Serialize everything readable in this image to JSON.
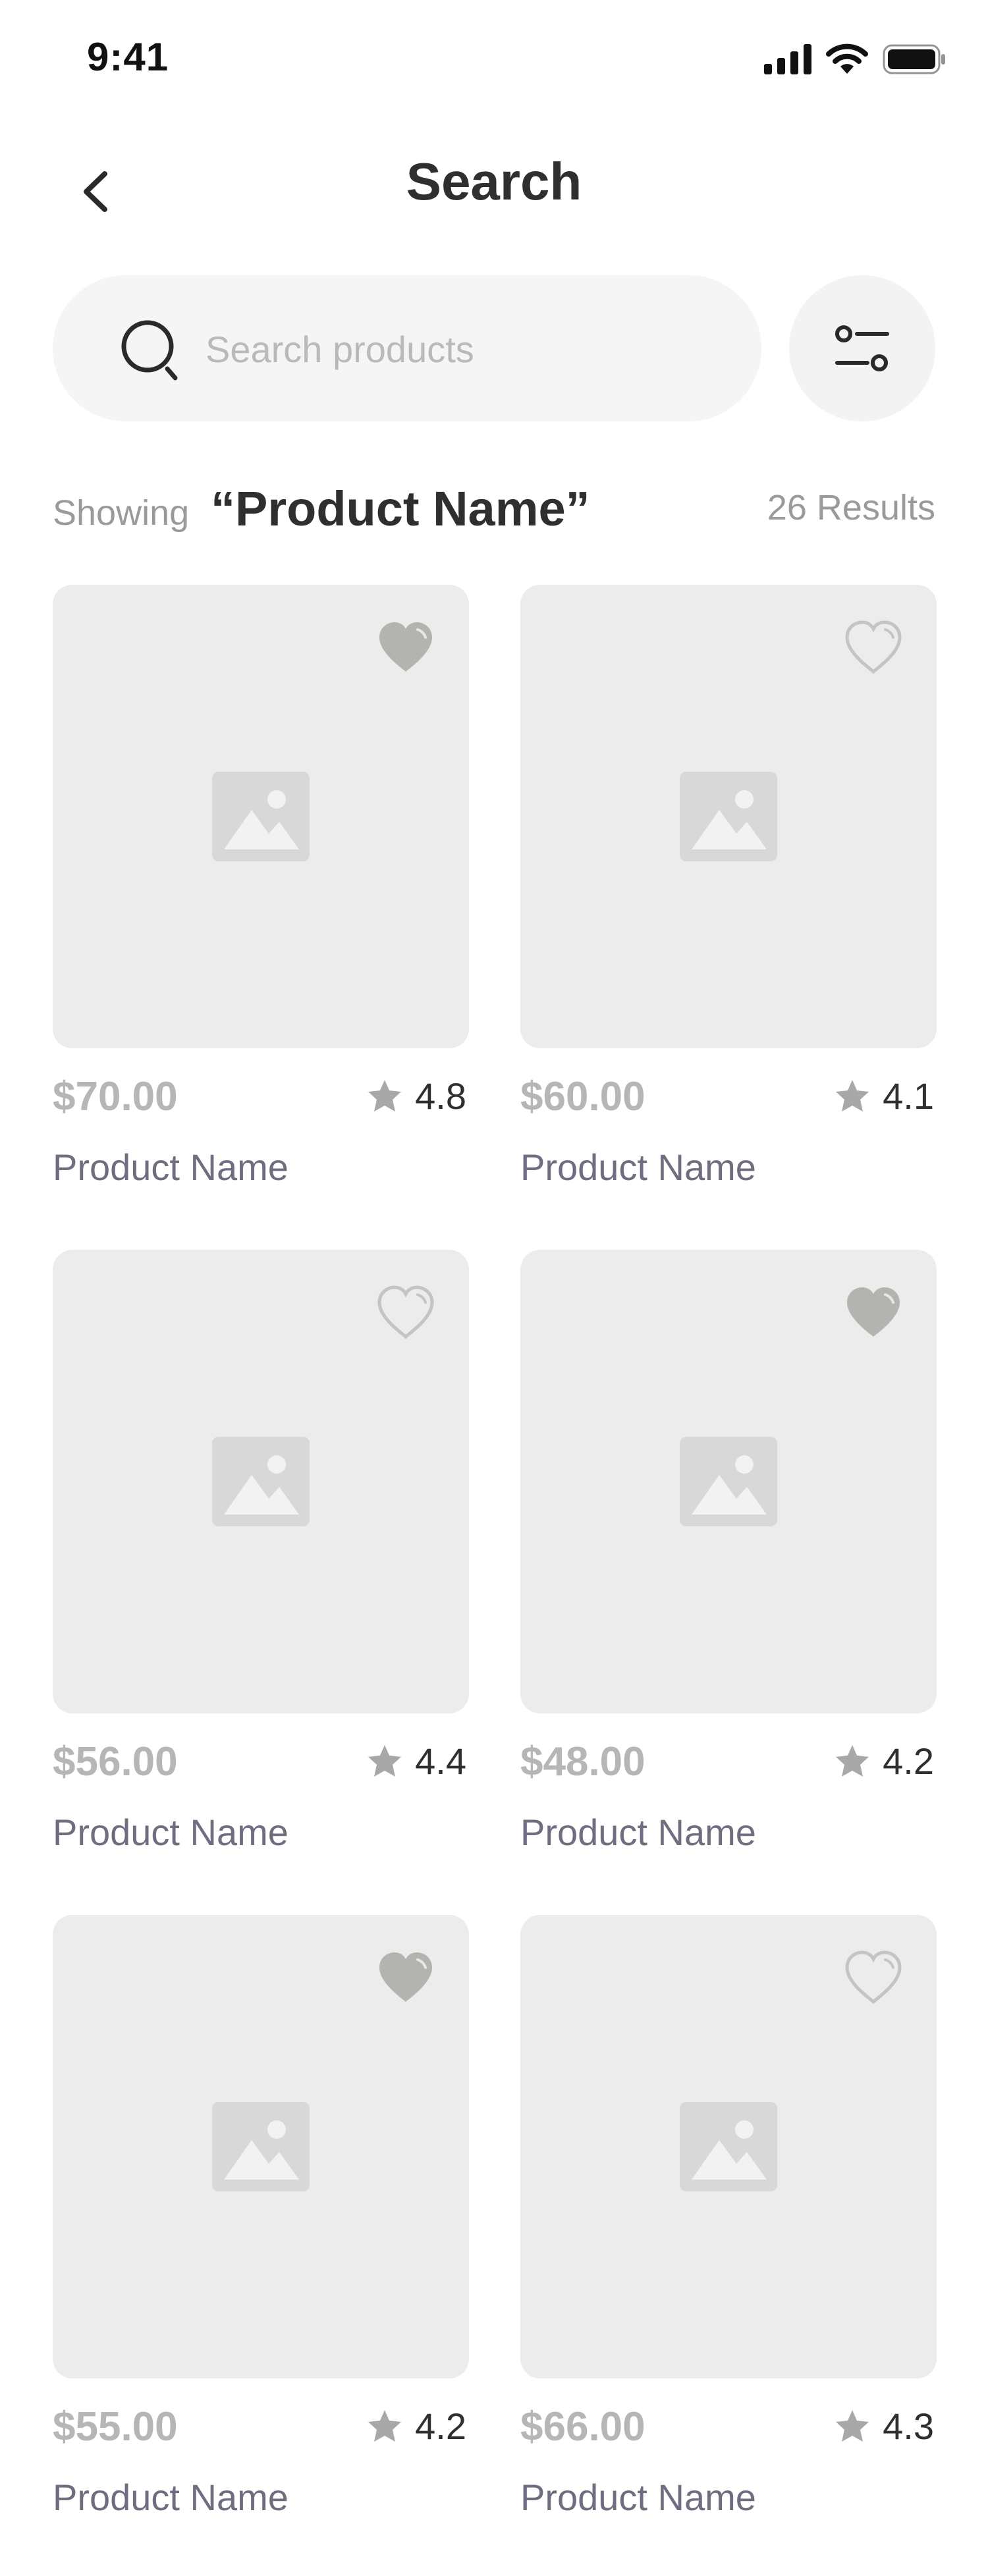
{
  "status_bar": {
    "time": "9:41",
    "icons": [
      "cellular-signal-icon",
      "wifi-icon",
      "battery-icon"
    ]
  },
  "header": {
    "back_icon": "chevron-left-icon",
    "title": "Search"
  },
  "search": {
    "icon": "search-icon",
    "placeholder": "Search products",
    "value": "",
    "filter_icon": "filter-sliders-icon"
  },
  "results": {
    "showing_label": "Showing",
    "query": "“Product Name”",
    "count": "26 Results"
  },
  "products": [
    {
      "price": "$70.00",
      "rating": "4.8",
      "name": "Product Name",
      "favorited": true
    },
    {
      "price": "$60.00",
      "rating": "4.1",
      "name": "Product Name",
      "favorited": false
    },
    {
      "price": "$56.00",
      "rating": "4.4",
      "name": "Product Name",
      "favorited": false
    },
    {
      "price": "$48.00",
      "rating": "4.2",
      "name": "Product Name",
      "favorited": true
    },
    {
      "price": "$55.00",
      "rating": "4.2",
      "name": "Product Name",
      "favorited": true
    },
    {
      "price": "$66.00",
      "rating": "4.3",
      "name": "Product Name",
      "favorited": false
    }
  ],
  "colors": {
    "card_background": "#ececec",
    "search_background": "#f5f5f5",
    "price": "#b6b6b6",
    "product_name": "#6e6e80",
    "heart_filled": "#b3b3b0",
    "heart_outline": "#c4c4c4",
    "star": "#a8a8a8"
  }
}
